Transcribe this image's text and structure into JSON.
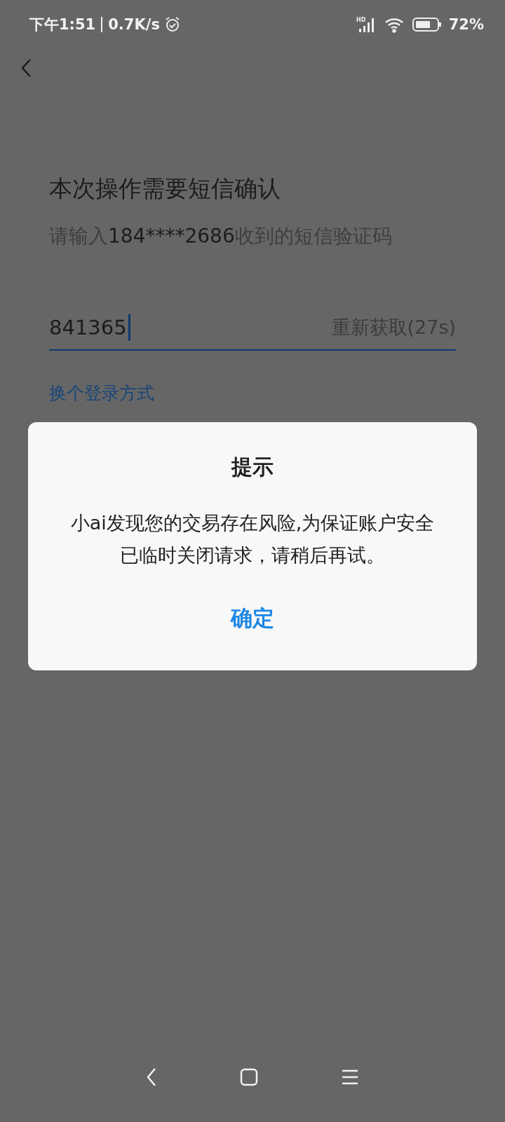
{
  "status_bar": {
    "time": "下午1:51",
    "speed": "0.7K/s",
    "network": "HD",
    "battery": "72%"
  },
  "title": "本次操作需要短信确认",
  "subtitle": [
    {
      "kind": "plain",
      "text": "请输入"
    },
    {
      "kind": "emphasis",
      "text": "184****2686"
    },
    {
      "kind": "plain",
      "text": "收到的短信验证码"
    }
  ],
  "code_field": {
    "value": "841365",
    "resend": "重新获取(27s)"
  },
  "switch_link": "换个登录方式",
  "dialog": {
    "title": "提示",
    "message": "小ai发现您的交易存在风险,为保证账户安全已临时关闭请求，请稍后再试。",
    "button": "确定"
  }
}
